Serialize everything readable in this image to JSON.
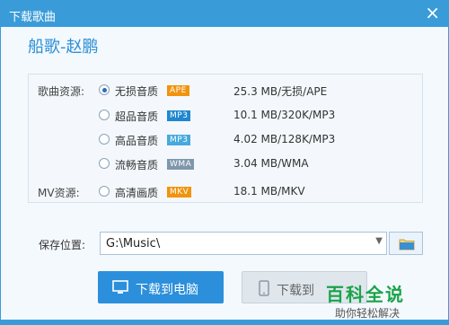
{
  "window": {
    "title": "下载歌曲",
    "close_glyph": "×"
  },
  "song_title": "船歌-赵鹏",
  "groups": {
    "song": "歌曲资源:",
    "mv": "MV资源:"
  },
  "options": [
    {
      "quality": "无损音质",
      "badge": "APE",
      "badge_color": "#f0940e",
      "size": "25.3 MB/无损/APE",
      "selected": true
    },
    {
      "quality": "超品音质",
      "badge": "MP3",
      "badge_color": "#1f87cf",
      "size": "10.1 MB/320K/MP3",
      "selected": false
    },
    {
      "quality": "高品音质",
      "badge": "MP3",
      "badge_color": "#47a9dc",
      "size": "4.02 MB/128K/MP3",
      "selected": false
    },
    {
      "quality": "流畅音质",
      "badge": "WMA",
      "badge_color": "#7e97ab",
      "size": "3.04 MB/WMA",
      "selected": false
    },
    {
      "quality": "高清画质",
      "badge": "MKV",
      "badge_color": "#f0940e",
      "size": "18.1 MB/MKV",
      "selected": false
    }
  ],
  "save": {
    "label": "保存位置:",
    "path": "G:\\Music\\",
    "dropdown_glyph": "▼"
  },
  "buttons": {
    "download_pc": "下载到电脑",
    "download_phone": "下载到"
  },
  "watermark": {
    "big": "百科全说",
    "small": "助你轻松解决"
  },
  "colors": {
    "accent": "#2b8fdb",
    "title_blue": "#2a8fd6",
    "watermark_green": "#1aa34a"
  }
}
